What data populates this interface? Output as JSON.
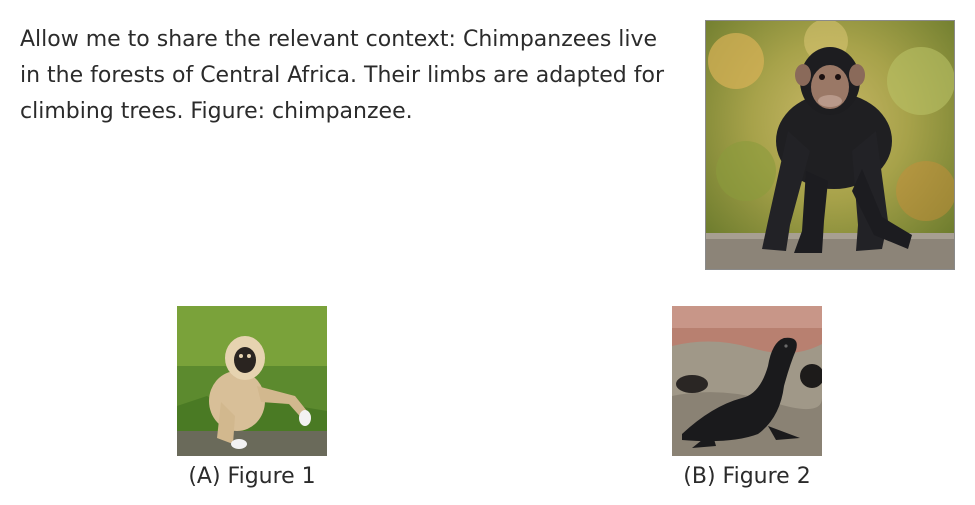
{
  "context": {
    "text": "Allow me to share the relevant context: Chimpanzees live in the forests of Central Africa. Their limbs are adapted for climbing trees. Figure: chimpanzee."
  },
  "options": [
    {
      "caption": "(A) Figure 1"
    },
    {
      "caption": "(B) Figure 2"
    }
  ],
  "colors": {
    "text": "#2b2b2b",
    "photo_border": "#8a8a8a"
  }
}
